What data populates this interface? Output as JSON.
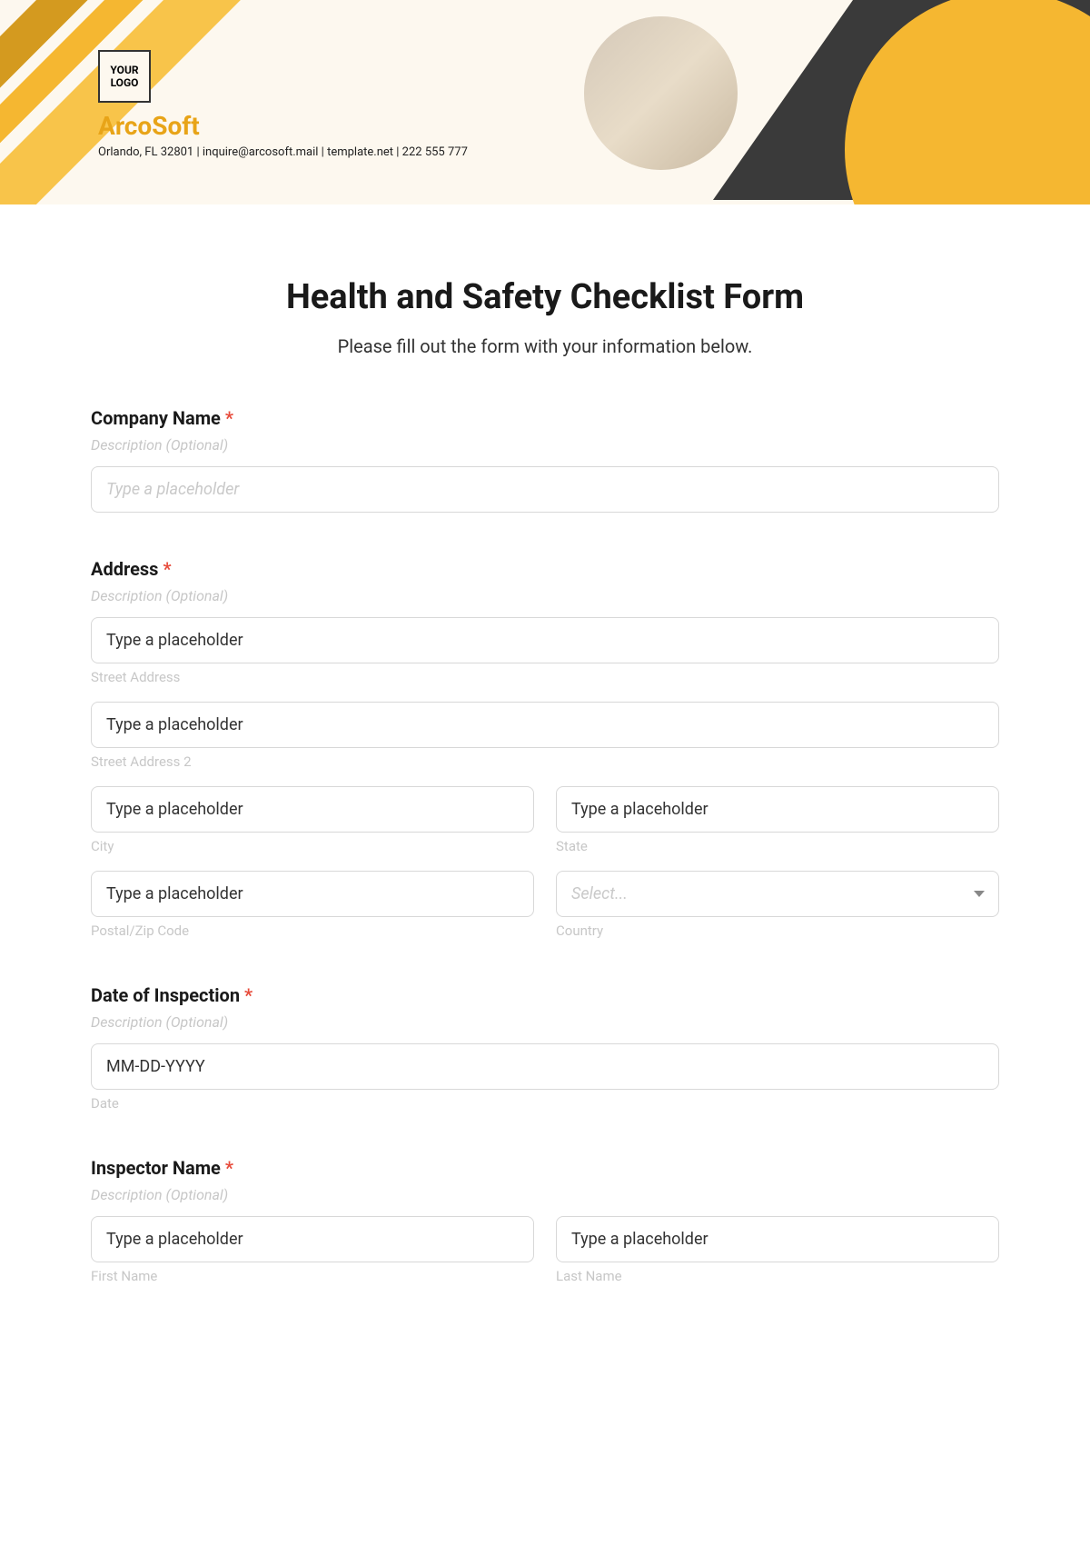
{
  "header": {
    "logo_text": "YOUR\nLOGO",
    "company_name": "ArcoSoft",
    "company_info": "Orlando, FL 32801 | inquire@arcosoft.mail | template.net | 222 555 777"
  },
  "form": {
    "title": "Health and Safety Checklist Form",
    "subtitle": "Please fill out the form with your information below."
  },
  "fields": {
    "company_name": {
      "label": "Company Name",
      "description": "Description (Optional)",
      "placeholder": "Type a placeholder"
    },
    "address": {
      "label": "Address",
      "description": "Description (Optional)",
      "street": {
        "placeholder": "Type a placeholder",
        "sublabel": "Street Address"
      },
      "street2": {
        "placeholder": "Type a placeholder",
        "sublabel": "Street Address 2"
      },
      "city": {
        "placeholder": "Type a placeholder",
        "sublabel": "City"
      },
      "state": {
        "placeholder": "Type a placeholder",
        "sublabel": "State"
      },
      "postal": {
        "placeholder": "Type a placeholder",
        "sublabel": "Postal/Zip Code"
      },
      "country": {
        "placeholder": "Select...",
        "sublabel": "Country"
      }
    },
    "inspection_date": {
      "label": "Date of Inspection",
      "description": "Description (Optional)",
      "placeholder": "MM-DD-YYYY",
      "sublabel": "Date"
    },
    "inspector_name": {
      "label": "Inspector Name",
      "description": "Description (Optional)",
      "first": {
        "placeholder": "Type a placeholder",
        "sublabel": "First Name"
      },
      "last": {
        "placeholder": "Type a placeholder",
        "sublabel": "Last Name"
      }
    }
  },
  "required_mark": "*"
}
